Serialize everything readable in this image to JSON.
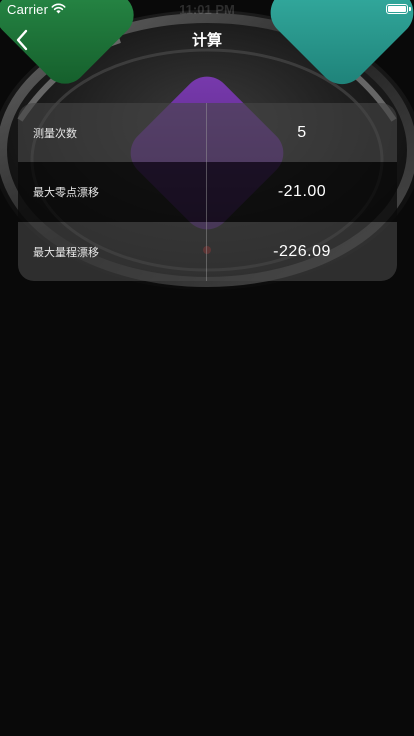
{
  "status_bar": {
    "carrier": "Carrier",
    "time": "11:01 PM",
    "wifi_icon": "wifi-icon",
    "battery_icon": "battery-icon"
  },
  "nav": {
    "back_icon": "chevron-left-icon",
    "title": "计算"
  },
  "results": {
    "rows": [
      {
        "label": "测量次数",
        "value": "5"
      },
      {
        "label": "最大零点漂移",
        "value": "-21.00"
      },
      {
        "label": "最大量程漂移",
        "value": "-226.09"
      }
    ]
  },
  "colors": {
    "background": "#090909",
    "pad_green": "#1e7a3c",
    "pad_teal": "#2aa59a",
    "pad_purple": "#5a2a86",
    "text": "#ffffff"
  }
}
